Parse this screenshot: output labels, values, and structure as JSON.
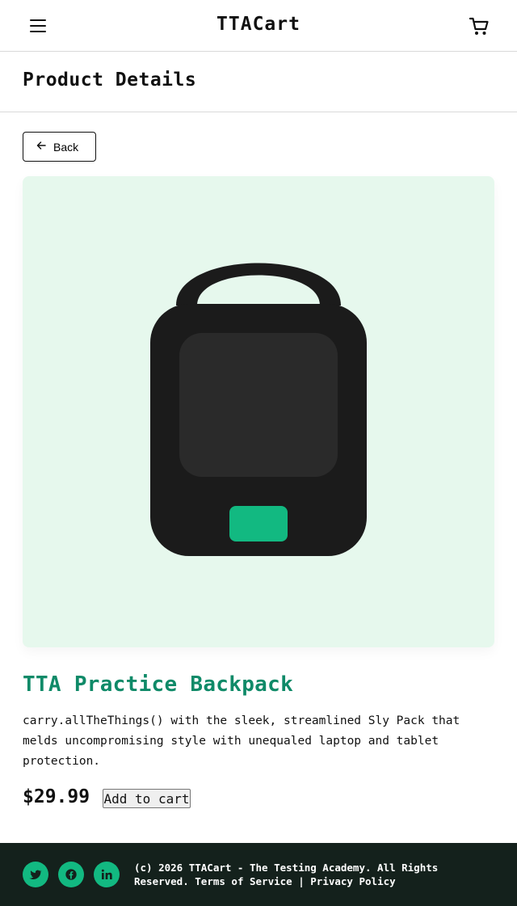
{
  "header": {
    "brand": "TTACart",
    "menu_icon": "hamburger-menu-icon",
    "cart_icon": "shopping-cart-icon"
  },
  "page": {
    "title": "Product Details"
  },
  "back_button": {
    "icon": "arrow-left-icon",
    "label": "Back"
  },
  "product": {
    "image_icon": "backpack-icon",
    "name": "TTA Practice Backpack",
    "description": "carry.allTheThings() with the sleek, streamlined Sly Pack that melds uncompromising style with unequaled laptop and tablet protection.",
    "price": "$29.99",
    "add_to_cart_label": "Add to cart"
  },
  "footer": {
    "social": [
      {
        "name": "twitter-icon"
      },
      {
        "name": "facebook-icon"
      },
      {
        "name": "linkedin-icon"
      }
    ],
    "copyright": "(c) 2026 TTACart - The Testing Academy. All Rights Reserved.",
    "terms_label": "Terms of Service",
    "separator": "|",
    "privacy_label": "Privacy Policy"
  },
  "colors": {
    "accent": "#12b981",
    "title_green": "#0f8a68",
    "image_bg": "#e6f8ed",
    "footer_bg": "#14211c"
  }
}
